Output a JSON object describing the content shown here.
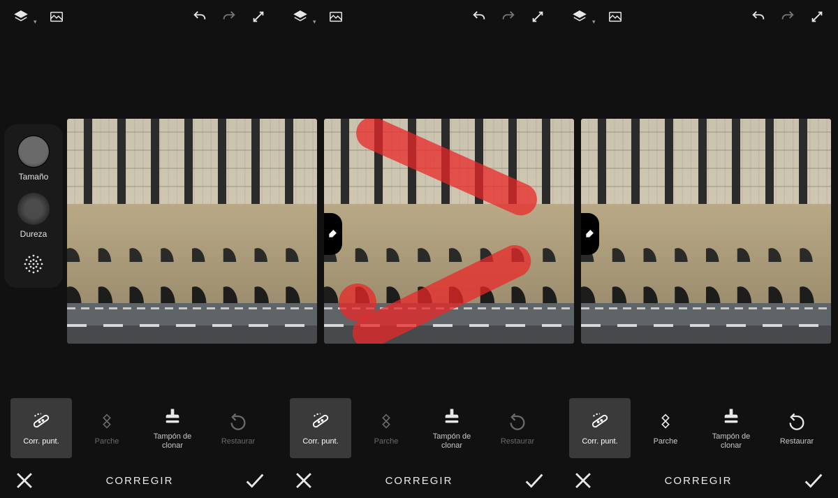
{
  "left_dock": {
    "size_label": "Tamaño",
    "hardness_label": "Dureza"
  },
  "tools": {
    "spot_heal": "Corr. punt.",
    "patch": "Parche",
    "clone_stamp": "Tampón de\nclonar",
    "restore": "Restaurar"
  },
  "confirm_title": "CORREGIR",
  "colors": {
    "brush_overlay": "#ea2828"
  }
}
